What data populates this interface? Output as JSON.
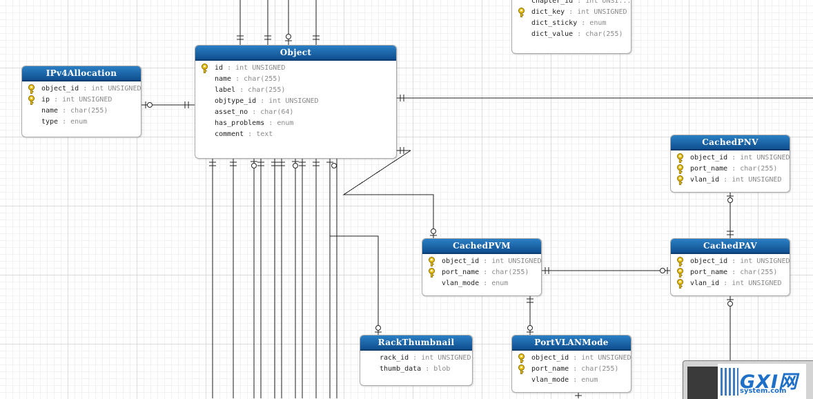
{
  "tables": {
    "ipv4": {
      "title": "IPv4Allocation",
      "fields": [
        {
          "name": "object_id",
          "type": "int UNSIGNED"
        },
        {
          "name": "ip",
          "type": "int UNSIGNED"
        },
        {
          "name": "name",
          "type": "char(255)"
        },
        {
          "name": "type",
          "type": "enum"
        }
      ]
    },
    "object": {
      "title": "Object",
      "fields": [
        {
          "name": "id",
          "type": "int UNSIGNED"
        },
        {
          "name": "name",
          "type": "char(255)"
        },
        {
          "name": "label",
          "type": "char(255)"
        },
        {
          "name": "objtype_id",
          "type": "int UNSIGNED"
        },
        {
          "name": "asset_no",
          "type": "char(64)"
        },
        {
          "name": "has_problems",
          "type": "enum"
        },
        {
          "name": "comment",
          "type": "text"
        }
      ]
    },
    "dict": {
      "fields": [
        {
          "name": "chapter_id",
          "type": "int UNSI..."
        },
        {
          "name": "dict_key",
          "type": "int UNSIGNED"
        },
        {
          "name": "dict_sticky",
          "type": "enum"
        },
        {
          "name": "dict_value",
          "type": "char(255)"
        }
      ]
    },
    "cachedpnv": {
      "title": "CachedPNV",
      "fields": [
        {
          "name": "object_id",
          "type": "int UNSIGNED"
        },
        {
          "name": "port_name",
          "type": "char(255)"
        },
        {
          "name": "vlan_id",
          "type": "int UNSIGNED"
        }
      ]
    },
    "cachedpvm": {
      "title": "CachedPVM",
      "fields": [
        {
          "name": "object_id",
          "type": "int UNSIGNED"
        },
        {
          "name": "port_name",
          "type": "char(255)"
        },
        {
          "name": "vlan_mode",
          "type": "enum"
        }
      ]
    },
    "cachedpav": {
      "title": "CachedPAV",
      "fields": [
        {
          "name": "object_id",
          "type": "int UNSIGNED"
        },
        {
          "name": "port_name",
          "type": "char(255)"
        },
        {
          "name": "vlan_id",
          "type": "int UNSIGNED"
        }
      ]
    },
    "rackthumb": {
      "title": "RackThumbnail",
      "fields": [
        {
          "name": "rack_id",
          "type": "int UNSIGNED"
        },
        {
          "name": "thumb_data",
          "type": "blob"
        }
      ]
    },
    "portvlanmode": {
      "title": "PortVLANMode",
      "fields": [
        {
          "name": "object_id",
          "type": "int UNSIGNED"
        },
        {
          "name": "port_name",
          "type": "char(255)"
        },
        {
          "name": "vlan_mode",
          "type": "enum"
        }
      ]
    }
  },
  "watermark": {
    "brand": "GXI网",
    "site": "system.com"
  },
  "colors": {
    "header_top": "#2b7fc4",
    "header_bottom": "#0f4f8f",
    "key_icon": "#e8c21a",
    "field_type": "#8a8a8a"
  }
}
